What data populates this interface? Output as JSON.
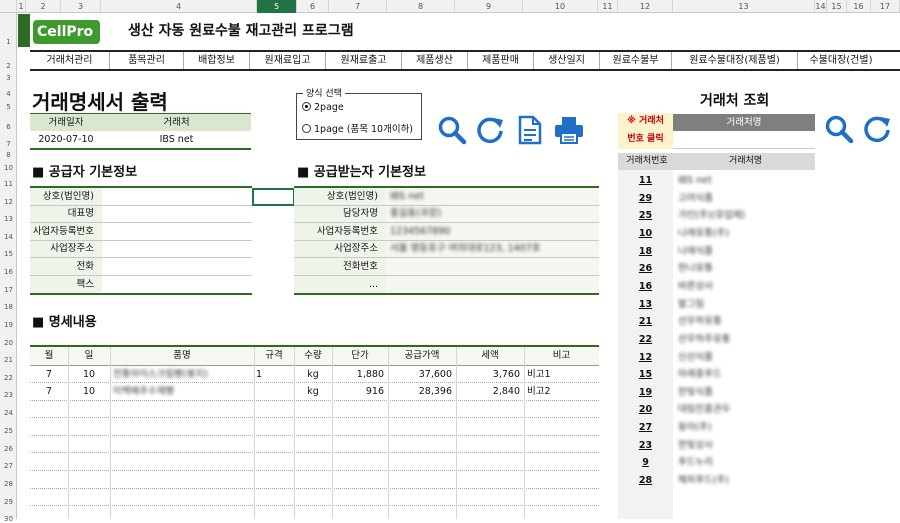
{
  "app": {
    "logo": "CellPro",
    "title": "생산 자동 원료수불 재고관리 프로그램"
  },
  "colheads": [
    "1",
    "2",
    "3",
    "4",
    "5",
    "6",
    "7",
    "8",
    "9",
    "10",
    "11",
    "12",
    "13",
    "14",
    "15",
    "16",
    "17"
  ],
  "rowheads": [
    "1",
    "2",
    "3",
    "4",
    "5",
    "6",
    "7",
    "8",
    "10",
    "11",
    "12",
    "13",
    "14",
    "15",
    "16",
    "17",
    "18",
    "19",
    "20",
    "21",
    "22",
    "23",
    "24",
    "25",
    "26",
    "27",
    "28",
    "29",
    "30"
  ],
  "menu": [
    "거래처관리",
    "품목관리",
    "배합정보",
    "원재료입고",
    "원재료출고",
    "제품생산",
    "제품판매",
    "생산일지",
    "원료수불부",
    "원료수불대장(제품별)",
    "수불대장(건별)"
  ],
  "page_title": "거래명세서 출력",
  "header_fields": {
    "date_label": "거래일자",
    "client_label": "거래처",
    "date": "2020-07-10",
    "client": "IBS net"
  },
  "form_select": {
    "legend": "양식 선택",
    "opt1": "2page",
    "opt2": "1page (품목 10개이하)",
    "selected": "2page"
  },
  "supplier": {
    "title": "■ 공급자 기본정보",
    "labels": [
      "상호(법인명)",
      "대표명",
      "사업자등록번호",
      "사업장주소",
      "전화",
      "팩스"
    ]
  },
  "receiver": {
    "title": "■ 공급받는자 기본정보",
    "labels": [
      "상호(법인명)",
      "담당자명",
      "사업자등록번호",
      "사업장주소",
      "전화번호",
      "..."
    ],
    "values": [
      "IBS net",
      "홍길동(과장)",
      "1234567890",
      "서울 영등포구 여의대로123, 1407호",
      "",
      ""
    ]
  },
  "detail": {
    "title": "■ 명세내용",
    "headers": [
      "월",
      "일",
      "품명",
      "규격",
      "수량",
      "단가",
      "공급가액",
      "세액",
      "비고"
    ],
    "rows": [
      [
        "7",
        "10",
        "전통아이스크림빵(봉지)",
        "1",
        "kg",
        "1,880",
        "37,600",
        "3,760",
        "비고1"
      ],
      [
        "7",
        "10",
        "이백배추수제빵",
        "",
        "kg",
        "916",
        "28,396",
        "2,840",
        "비고2"
      ]
    ]
  },
  "lookup": {
    "title": "거래처 조회",
    "hint1": "※ 거래처",
    "hint2": "번호 클릭",
    "top_header": "거래처명",
    "col1": "거래처번호",
    "col2": "거래처명",
    "items": [
      [
        "11",
        "IBS net"
      ],
      [
        "29",
        "고려식품"
      ],
      [
        "25",
        "가인(주)(유업체)"
      ],
      [
        "10",
        "나래유통(주)"
      ],
      [
        "18",
        "나래식품"
      ],
      [
        "26",
        "한나유통"
      ],
      [
        "16",
        "바른상사"
      ],
      [
        "13",
        "발그림"
      ],
      [
        "21",
        "선우하유통"
      ],
      [
        "22",
        "선우하주유통"
      ],
      [
        "12",
        "신선식품"
      ],
      [
        "15",
        "아래중푸드"
      ],
      [
        "19",
        "한빛식품"
      ],
      [
        "20",
        "대림진흥관두"
      ],
      [
        "27",
        "동아(주)"
      ],
      [
        "23",
        "한빛상사"
      ],
      [
        "9",
        "푸드누리"
      ],
      [
        "28",
        "해피푸드(주)"
      ]
    ]
  },
  "colors": {
    "accent": "#2e6b22",
    "hint_red": "#c00000",
    "icon_blue": "#1f6fc9"
  }
}
